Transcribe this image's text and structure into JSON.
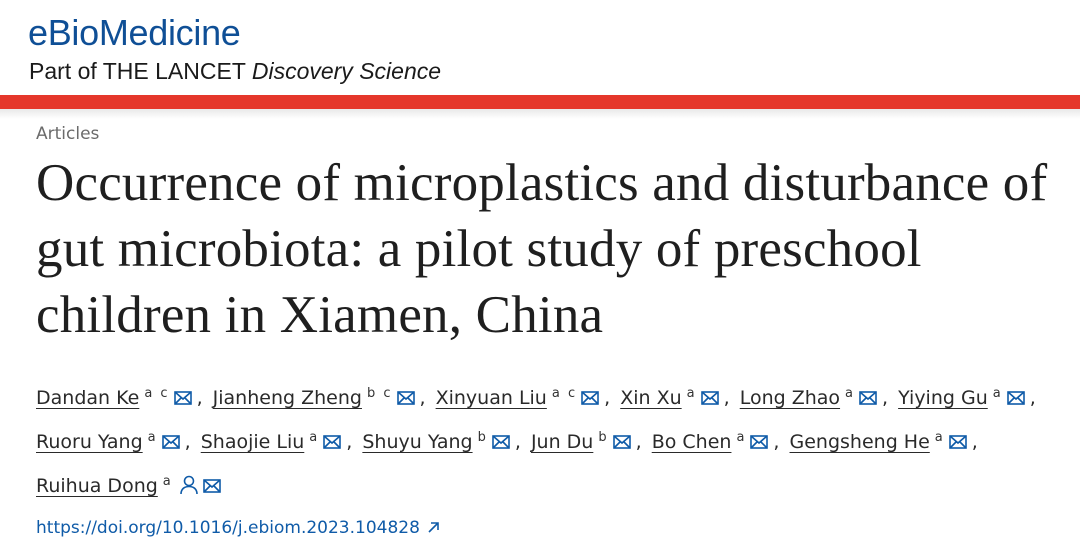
{
  "journal": {
    "name": "eBioMedicine",
    "part_of": "Part of ",
    "publisher": "THE LANCET",
    "collection": "Discovery Science"
  },
  "article": {
    "type": "Articles",
    "title": "Occurrence of microplastics and disturbance of gut microbiota: a pilot study of preschool children in Xiamen, China",
    "doi": "https://doi.org/10.1016/j.ebiom.2023.104828"
  },
  "authors": [
    {
      "name": "Dandan Ke",
      "aff": "a c"
    },
    {
      "name": "Jianheng Zheng",
      "aff": "b c"
    },
    {
      "name": "Xinyuan Liu",
      "aff": "a c"
    },
    {
      "name": "Xin Xu",
      "aff": "a"
    },
    {
      "name": "Long Zhao",
      "aff": "a"
    },
    {
      "name": "Yiying Gu",
      "aff": "a"
    },
    {
      "name": "Ruoru Yang",
      "aff": "a"
    },
    {
      "name": "Shaojie Liu",
      "aff": "a"
    },
    {
      "name": "Shuyu Yang",
      "aff": "b"
    },
    {
      "name": "Jun Du",
      "aff": "b"
    },
    {
      "name": "Bo Chen",
      "aff": "a"
    },
    {
      "name": "Gengsheng He",
      "aff": "a"
    },
    {
      "name": "Ruihua Dong",
      "aff": "a"
    }
  ],
  "colors": {
    "brand_blue": "#0f4f96",
    "lancet_red": "#e5372b",
    "link_blue": "#0f5ba8"
  },
  "icons": {
    "email": "envelope-icon",
    "corresponding": "person-icon",
    "external": "external-link-icon"
  }
}
